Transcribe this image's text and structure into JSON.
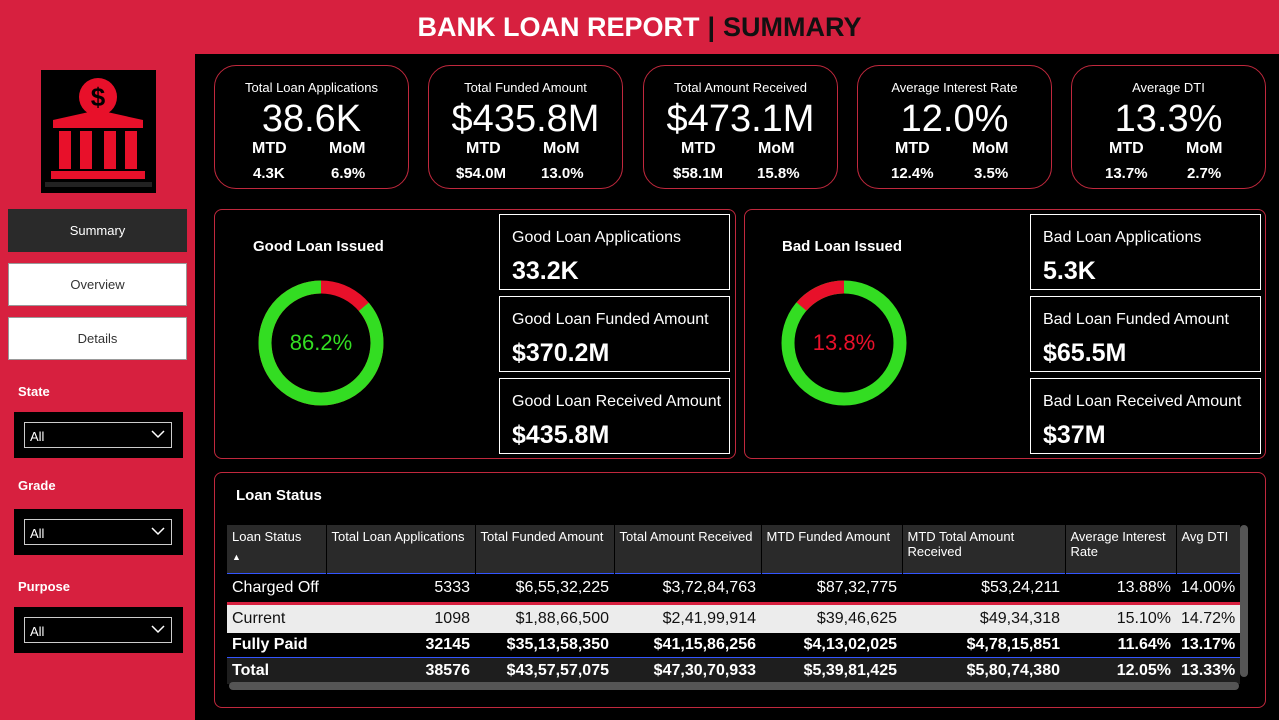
{
  "header": {
    "title": "BANK LOAN REPORT",
    "separator": "|",
    "subtitle": "SUMMARY"
  },
  "colors": {
    "brand_red": "#d7203f",
    "good_green": "#33dd22",
    "bad_red": "#e8102a",
    "panel_bg": "#000000"
  },
  "nav": {
    "summary": "Summary",
    "overview": "Overview",
    "details": "Details"
  },
  "filters": [
    {
      "label": "State",
      "value": "All"
    },
    {
      "label": "Grade",
      "value": "All"
    },
    {
      "label": "Purpose",
      "value": "All"
    }
  ],
  "kpis": [
    {
      "title": "Total Loan Applications",
      "value": "38.6K",
      "mtd_label": "MTD",
      "mom_label": "MoM",
      "mtd": "4.3K",
      "mom": "6.9%"
    },
    {
      "title": "Total Funded Amount",
      "value": "$435.8M",
      "mtd_label": "MTD",
      "mom_label": "MoM",
      "mtd": "$54.0M",
      "mom": "13.0%"
    },
    {
      "title": "Total Amount Received",
      "value": "$473.1M",
      "mtd_label": "MTD",
      "mom_label": "MoM",
      "mtd": "$58.1M",
      "mom": "15.8%"
    },
    {
      "title": "Average Interest Rate",
      "value": "12.0%",
      "mtd_label": "MTD",
      "mom_label": "MoM",
      "mtd": "12.4%",
      "mom": "3.5%"
    },
    {
      "title": "Average DTI",
      "value": "13.3%",
      "mtd_label": "MTD",
      "mom_label": "MoM",
      "mtd": "13.7%",
      "mom": "2.7%"
    }
  ],
  "good": {
    "title": "Good Loan Issued",
    "pct_label": "86.2%",
    "pct": 0.862,
    "cards": [
      {
        "title": "Good Loan Applications",
        "value": "33.2K"
      },
      {
        "title": "Good Loan Funded Amount",
        "value": "$370.2M"
      },
      {
        "title": "Good Loan Received Amount",
        "value": "$435.8M"
      }
    ]
  },
  "bad": {
    "title": "Bad Loan Issued",
    "pct_label": "13.8%",
    "pct": 0.138,
    "cards": [
      {
        "title": "Bad Loan Applications",
        "value": "5.3K"
      },
      {
        "title": "Bad Loan Funded Amount",
        "value": "$65.5M"
      },
      {
        "title": "Bad Loan Received Amount",
        "value": "$37M"
      }
    ]
  },
  "loan_status": {
    "title": "Loan Status",
    "columns": [
      "Loan Status",
      "Total Loan Applications",
      "Total Funded Amount",
      "Total Amount Received",
      "MTD Funded Amount",
      "MTD Total Amount Received",
      "Average Interest Rate",
      "Avg DTI"
    ],
    "rows": [
      [
        "Charged Off",
        "5333",
        "$6,55,32,225",
        "$3,72,84,763",
        "$87,32,775",
        "$53,24,211",
        "13.88%",
        "14.00%"
      ],
      [
        "Current",
        "1098",
        "$1,88,66,500",
        "$2,41,99,914",
        "$39,46,625",
        "$49,34,318",
        "15.10%",
        "14.72%"
      ],
      [
        "Fully Paid",
        "32145",
        "$35,13,58,350",
        "$41,15,86,256",
        "$4,13,02,025",
        "$4,78,15,851",
        "11.64%",
        "13.17%"
      ]
    ],
    "total": [
      "Total",
      "38576",
      "$43,57,57,075",
      "$47,30,70,933",
      "$5,39,81,425",
      "$5,80,74,380",
      "12.05%",
      "13.33%"
    ]
  }
}
